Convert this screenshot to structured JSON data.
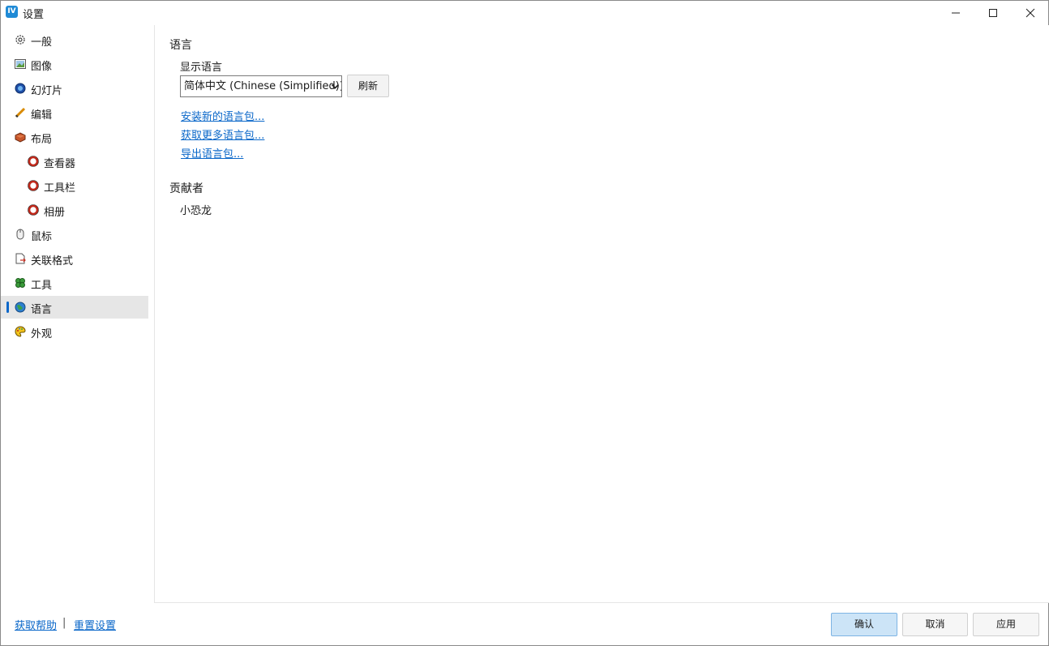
{
  "window": {
    "title": "设置",
    "app_icon_text": "IV",
    "accent_color": "#0a67c9"
  },
  "sidebar": {
    "items": [
      {
        "label": "一般",
        "icon": "gear-icon"
      },
      {
        "label": "图像",
        "icon": "image-icon"
      },
      {
        "label": "幻灯片",
        "icon": "slideshow-icon"
      },
      {
        "label": "编辑",
        "icon": "pencil-icon"
      },
      {
        "label": "布局",
        "icon": "layout-icon"
      },
      {
        "label": "查看器",
        "icon": "ring-icon"
      },
      {
        "label": "工具栏",
        "icon": "ring-icon"
      },
      {
        "label": "相册",
        "icon": "ring-icon"
      },
      {
        "label": "鼠标",
        "icon": "mouse-icon"
      },
      {
        "label": "关联格式",
        "icon": "file-association-icon"
      },
      {
        "label": "工具",
        "icon": "tools-icon"
      },
      {
        "label": "语言",
        "icon": "globe-icon",
        "selected": true
      },
      {
        "label": "外观",
        "icon": "palette-icon"
      }
    ]
  },
  "main": {
    "language_heading": "语言",
    "display_language_label": "显示语言",
    "selected_language": "简体中文 (Chinese (Simplified))",
    "refresh_label": "刷新",
    "install_link": "安装新的语言包...",
    "get_more_link": "获取更多语言包...",
    "export_link": "导出语言包...",
    "contributors_heading": "贡献者",
    "contributor_name": "小恐龙"
  },
  "footer": {
    "help_link": "获取帮助",
    "separator": "|",
    "reset_link": "重置设置",
    "ok_label": "确认",
    "cancel_label": "取消",
    "apply_label": "应用"
  }
}
